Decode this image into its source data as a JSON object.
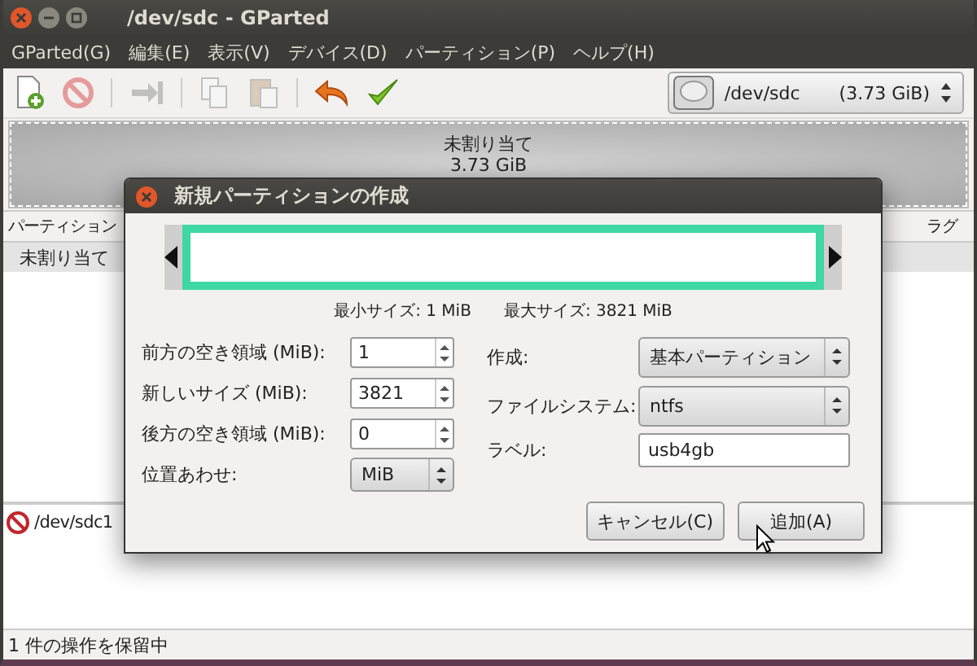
{
  "window": {
    "title": "/dev/sdc - GParted"
  },
  "menu": [
    "GParted(G)",
    "編集(E)",
    "表示(V)",
    "デバイス(D)",
    "パーティション(P)",
    "ヘルプ(H)"
  ],
  "toolbar": [
    {
      "kind": "new",
      "disabled": false
    },
    {
      "kind": "delete",
      "disabled": true
    },
    {
      "kind": "sep"
    },
    {
      "kind": "resize",
      "disabled": true
    },
    {
      "kind": "sep"
    },
    {
      "kind": "copy",
      "disabled": true
    },
    {
      "kind": "paste",
      "disabled": true
    },
    {
      "kind": "sep"
    },
    {
      "kind": "undo",
      "disabled": false
    },
    {
      "kind": "apply",
      "disabled": false
    }
  ],
  "device": {
    "name": "/dev/sdc",
    "size": "(3.73 GiB)"
  },
  "disk_map": {
    "label": "未割り当て",
    "size": "3.73 GiB"
  },
  "table": {
    "columns": [
      "パーティション",
      "ラグ"
    ],
    "rows": [
      {
        "column_1": "未割り当て"
      }
    ]
  },
  "pending": [
    {
      "text": "/dev/sdc1"
    }
  ],
  "status_bar": "1 件の操作を保留中",
  "dialog": {
    "title": "新規パーティションの作成",
    "min_size": "最小サイズ: 1 MiB",
    "max_size": "最大サイズ: 3821 MiB",
    "left": [
      {
        "kind": "spin",
        "label": "前方の空き領域 (MiB):",
        "value": "1"
      },
      {
        "kind": "spin",
        "label": "新しいサイズ (MiB):",
        "value": "3821"
      },
      {
        "kind": "spin",
        "label": "後方の空き領域 (MiB):",
        "value": "0"
      },
      {
        "kind": "combo",
        "label": "位置あわせ:",
        "value": "MiB"
      }
    ],
    "right": [
      {
        "kind": "combo",
        "label": "作成:",
        "value": "基本パーティション"
      },
      {
        "kind": "combo",
        "label": "ファイルシステム:",
        "value": "ntfs"
      },
      {
        "kind": "text",
        "label": "ラベル:",
        "value": "usb4gb"
      }
    ],
    "buttons": [
      "キャンセル(C)",
      "追加(A)"
    ]
  }
}
